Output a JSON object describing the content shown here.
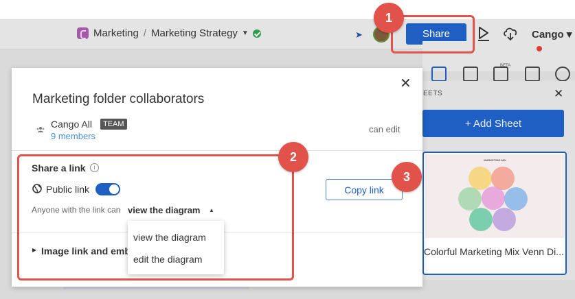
{
  "header": {
    "breadcrumb_folder": "Marketing",
    "breadcrumb_sep": "/",
    "breadcrumb_doc": "Marketing Strategy",
    "share_label": "Share",
    "account_label": "Cango",
    "account_caret": "▾"
  },
  "side_panel": {
    "sheets_label": "EETS",
    "add_sheet_label": "+ Add Sheet",
    "thumbnail_title": "MARKETING MIX",
    "thumbnail_caption": "Colorful Marketing Mix Venn Di...",
    "beta_badge": "BETA"
  },
  "modal": {
    "title": "Marketing folder collaborators",
    "close_glyph": "✕",
    "collaborator": {
      "name": "Cango All",
      "badge": "TEAM",
      "members": "9 members",
      "permission": "can edit"
    },
    "share_link": {
      "label": "Share a link",
      "info_glyph": "i",
      "public_label": "Public link",
      "public_enabled": true,
      "copy_label": "Copy link",
      "anyone_text": "Anyone with the link can",
      "permission_value": "view the diagram",
      "permission_caret": "▲"
    },
    "image_link_label": "Image link and emb",
    "image_link_caret": "▶"
  },
  "dropdown": {
    "options": [
      "view the diagram",
      "edit the diagram"
    ]
  },
  "annotations": [
    "1",
    "2",
    "3"
  ],
  "colors": {
    "accent": "#1f5fc4",
    "annotation": "#e0524a",
    "link": "#4a8fd6"
  }
}
